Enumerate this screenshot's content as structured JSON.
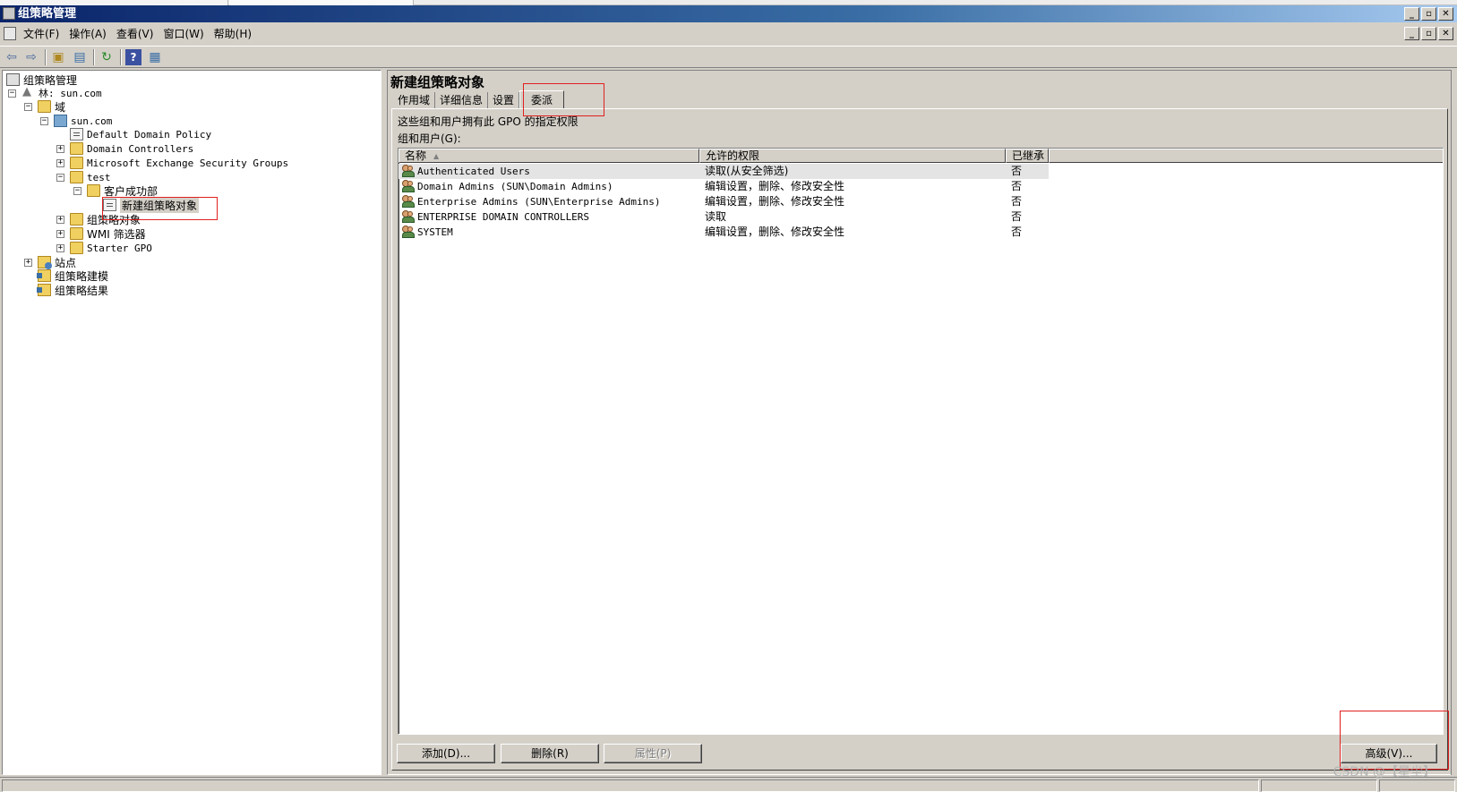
{
  "window": {
    "title": "组策略管理",
    "controls": [
      "_",
      "▫",
      "✕"
    ]
  },
  "menu": [
    "文件(F)",
    "操作(A)",
    "查看(V)",
    "窗口(W)",
    "帮助(H)"
  ],
  "toolbar_icons": [
    "back-icon",
    "forward-icon",
    "up-folder-icon",
    "show-hide-tree-icon",
    "refresh-icon",
    "help-icon",
    "properties-icon"
  ],
  "tree": {
    "root": "组策略管理",
    "forest": "林: sun.com",
    "domains": "域",
    "domain": "sun.com",
    "default_policy": "Default Domain Policy",
    "domain_controllers": "Domain Controllers",
    "exchange_groups": "Microsoft Exchange Security Groups",
    "test_ou": "test",
    "sub_ou": "客户成功部",
    "new_gpo": "新建组策略对象",
    "gpo_objects": "组策略对象",
    "wmi_filters": "WMI 筛选器",
    "starter_gpo": "Starter GPO",
    "sites": "站点",
    "modeling": "组策略建模",
    "results": "组策略结果"
  },
  "right": {
    "title": "新建组策略对象",
    "tabs": [
      "作用域",
      "详细信息",
      "设置",
      "委派"
    ],
    "description": "这些组和用户拥有此 GPO 的指定权限",
    "groups_label": "组和用户(G):",
    "columns": [
      "名称",
      "允许的权限",
      "已继承"
    ],
    "rows": [
      {
        "name": "Authenticated Users",
        "permission": "读取(从安全筛选)",
        "inherited": "否"
      },
      {
        "name": "Domain Admins (SUN\\Domain Admins)",
        "permission": "编辑设置，删除、修改安全性",
        "inherited": "否"
      },
      {
        "name": "Enterprise Admins (SUN\\Enterprise Admins)",
        "permission": "编辑设置，删除、修改安全性",
        "inherited": "否"
      },
      {
        "name": "ENTERPRISE DOMAIN CONTROLLERS",
        "permission": "读取",
        "inherited": "否"
      },
      {
        "name": "SYSTEM",
        "permission": "编辑设置，删除、修改安全性",
        "inherited": "否"
      }
    ],
    "buttons": {
      "add": "添加(D)...",
      "remove": "删除(R)",
      "properties": "属性(P)",
      "advanced": "高级(V)..."
    }
  },
  "watermark": "CSDN @【星尘】"
}
